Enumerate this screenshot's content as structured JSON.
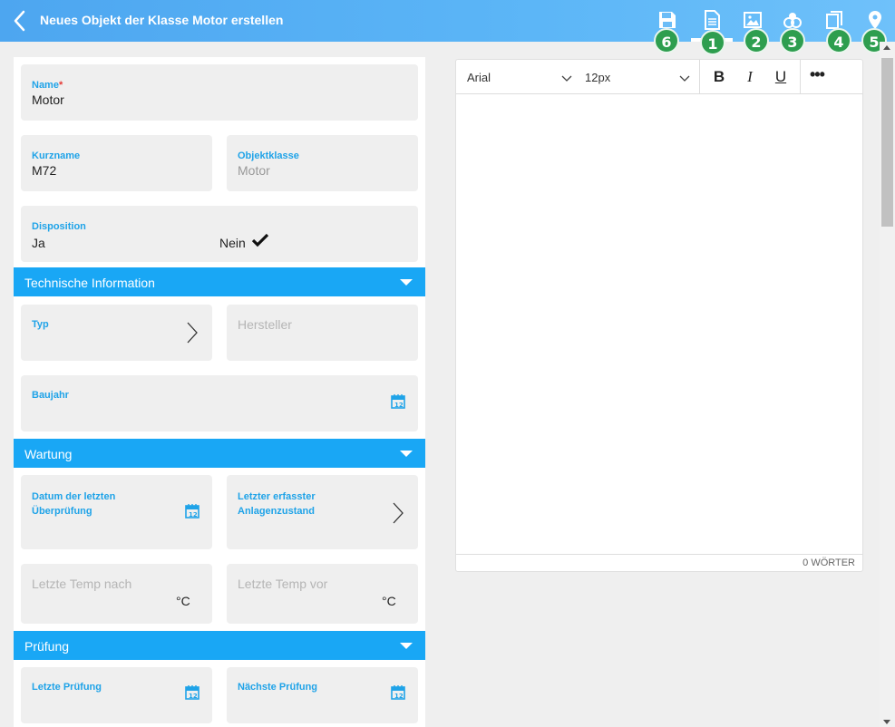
{
  "header": {
    "title": "Neues Objekt der Klasse Motor erstellen",
    "icons": [
      "back-icon",
      "save-icon",
      "document-icon",
      "image-icon",
      "tools-icon",
      "copy-icon",
      "location-icon"
    ],
    "badges": [
      "6",
      "1",
      "2",
      "3",
      "4",
      "5"
    ]
  },
  "form": {
    "name": {
      "label": "Name",
      "required_mark": "*",
      "value": "Motor"
    },
    "kurzname": {
      "label": "Kurzname",
      "value": "M72"
    },
    "objektklasse": {
      "label": "Objektklasse",
      "value": "Motor"
    },
    "disposition": {
      "label": "Disposition",
      "option_yes": "Ja",
      "option_no": "Nein",
      "selected": "Nein"
    },
    "sections": {
      "technisch": {
        "title": "Technische Information",
        "typ": {
          "label": "Typ"
        },
        "hersteller": {
          "placeholder": "Hersteller"
        },
        "baujahr": {
          "label": "Baujahr"
        }
      },
      "wartung": {
        "title": "Wartung",
        "datum_letzte_line1": "Datum der letzten",
        "datum_letzte_line2": "Überprüfung",
        "letzter_zustand_line1": "Letzter erfasster",
        "letzter_zustand_line2": "Anlagenzustand",
        "temp_nach": {
          "placeholder": "Letzte Temp nach",
          "unit": "°C"
        },
        "temp_vor": {
          "placeholder": "Letzte Temp vor",
          "unit": "°C"
        }
      },
      "pruefung": {
        "title": "Prüfung",
        "letzte": {
          "label": "Letzte Prüfung"
        },
        "naechste": {
          "label": "Nächste Prüfung"
        }
      }
    }
  },
  "editor": {
    "font": "Arial",
    "size": "12px",
    "bold": "B",
    "italic": "I",
    "underline": "U",
    "more": "•••",
    "wordcount": "0 WÖRTER"
  },
  "colors": {
    "header": "#5cb6f7",
    "section": "#19a7f5",
    "label": "#1fa3e8",
    "badge": "#2e9e4f"
  }
}
